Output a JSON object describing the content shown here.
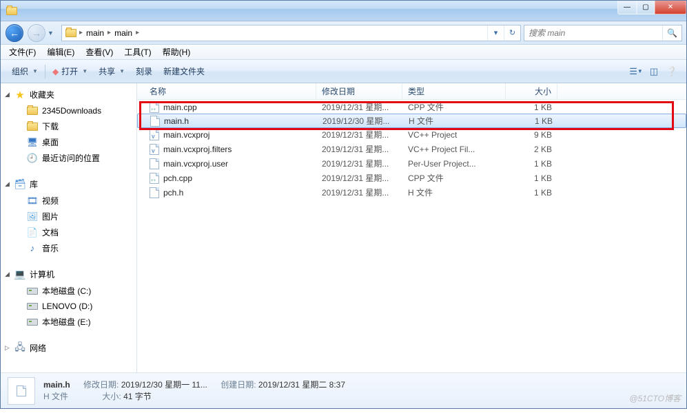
{
  "breadcrumbs": [
    "main",
    "main"
  ],
  "search_placeholder": "搜索 main",
  "menubar": [
    {
      "label": "文件(F)"
    },
    {
      "label": "编辑(E)"
    },
    {
      "label": "查看(V)"
    },
    {
      "label": "工具(T)"
    },
    {
      "label": "帮助(H)"
    }
  ],
  "toolbar": {
    "organize": "组织",
    "open": "打开",
    "share": "共享",
    "burn": "刻录",
    "new_folder": "新建文件夹"
  },
  "sidebar": {
    "favorites": {
      "label": "收藏夹",
      "items": [
        {
          "label": "2345Downloads",
          "icon": "folder"
        },
        {
          "label": "下载",
          "icon": "folder"
        },
        {
          "label": "桌面",
          "icon": "desktop"
        },
        {
          "label": "最近访问的位置",
          "icon": "recent"
        }
      ]
    },
    "libraries": {
      "label": "库",
      "items": [
        {
          "label": "视频",
          "icon": "video"
        },
        {
          "label": "图片",
          "icon": "pictures"
        },
        {
          "label": "文档",
          "icon": "documents"
        },
        {
          "label": "音乐",
          "icon": "music"
        }
      ]
    },
    "computer": {
      "label": "计算机",
      "items": [
        {
          "label": "本地磁盘 (C:)",
          "icon": "drive"
        },
        {
          "label": "LENOVO (D:)",
          "icon": "drive"
        },
        {
          "label": "本地磁盘 (E:)",
          "icon": "drive"
        }
      ]
    },
    "network": {
      "label": "网络"
    }
  },
  "columns": {
    "name": "名称",
    "date": "修改日期",
    "type": "类型",
    "size": "大小"
  },
  "files": [
    {
      "name": "main.cpp",
      "date": "2019/12/31 星期...",
      "type": "CPP 文件",
      "size": "1 KB",
      "icon": "cpp",
      "selected": false
    },
    {
      "name": "main.h",
      "date": "2019/12/30 星期...",
      "type": "H 文件",
      "size": "1 KB",
      "icon": "file",
      "selected": true
    },
    {
      "name": "main.vcxproj",
      "date": "2019/12/31 星期...",
      "type": "VC++ Project",
      "size": "9 KB",
      "icon": "vcx",
      "selected": false
    },
    {
      "name": "main.vcxproj.filters",
      "date": "2019/12/31 星期...",
      "type": "VC++ Project Fil...",
      "size": "2 KB",
      "icon": "vcx",
      "selected": false
    },
    {
      "name": "main.vcxproj.user",
      "date": "2019/12/31 星期...",
      "type": "Per-User Project...",
      "size": "1 KB",
      "icon": "file",
      "selected": false
    },
    {
      "name": "pch.cpp",
      "date": "2019/12/31 星期...",
      "type": "CPP 文件",
      "size": "1 KB",
      "icon": "cpp",
      "selected": false
    },
    {
      "name": "pch.h",
      "date": "2019/12/31 星期...",
      "type": "H 文件",
      "size": "1 KB",
      "icon": "file",
      "selected": false
    }
  ],
  "details": {
    "name": "main.h",
    "mod_label": "修改日期:",
    "mod": "2019/12/30 星期一 11...",
    "created_label": "创建日期:",
    "created": "2019/12/31 星期二 8:37",
    "type": "H 文件",
    "size_label": "大小:",
    "size": "41 字节"
  },
  "watermark": "@51CTO博客"
}
